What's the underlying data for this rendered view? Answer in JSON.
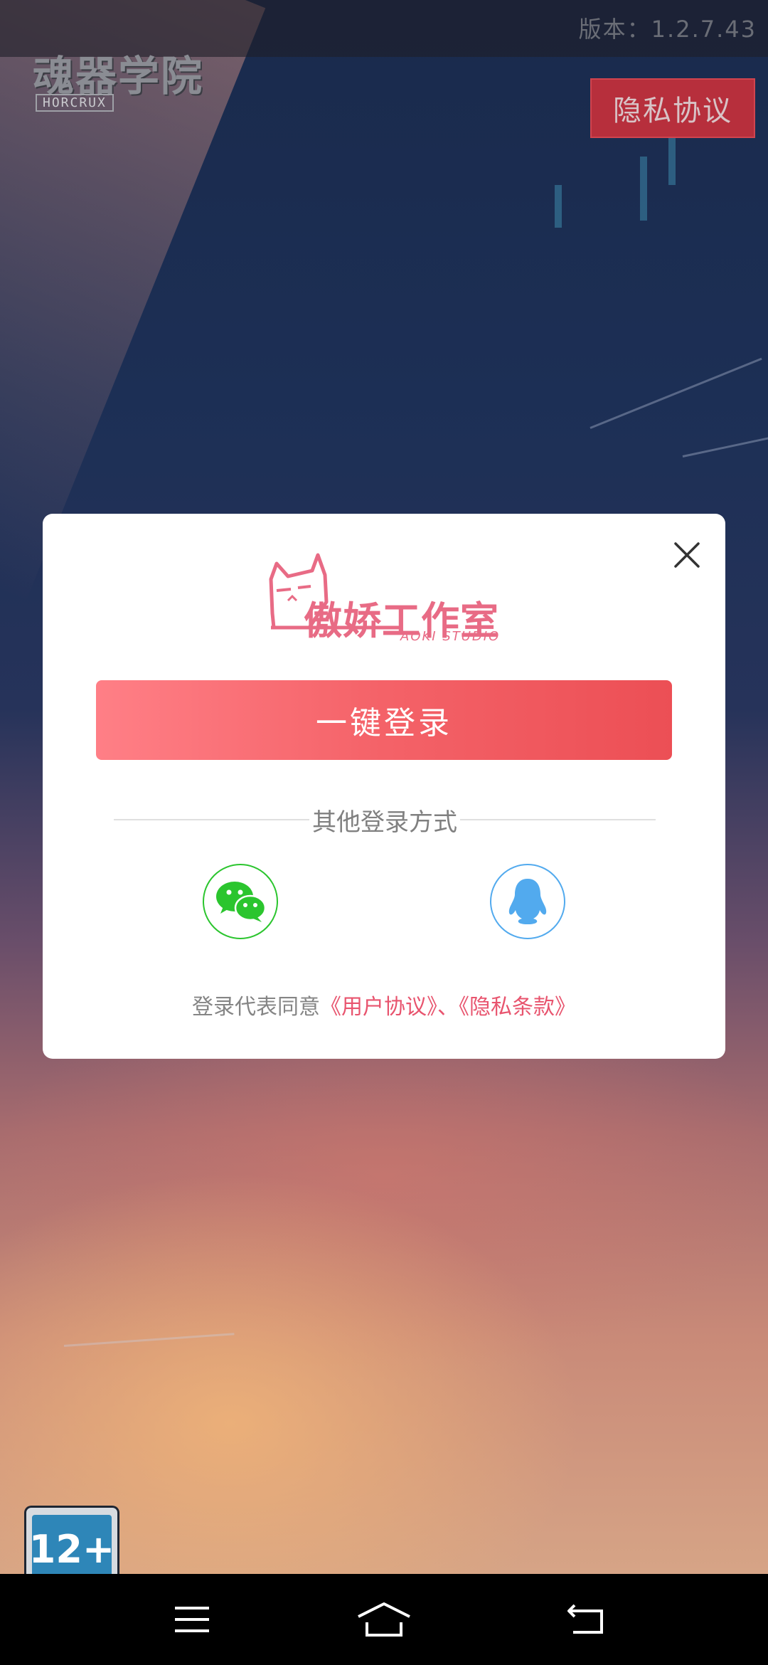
{
  "header": {
    "logo_cn": "魂器学院",
    "logo_en": "HORCRUX",
    "version": "版本：1.2.7.43",
    "privacy_button": "隐私协议"
  },
  "age_rating": "12+",
  "login_dialog": {
    "studio_logo_cn": "傲娇工作室",
    "studio_logo_en": "AOKI STUDIO",
    "one_click_login": "一键登录",
    "other_methods": "其他登录方式",
    "agreement": {
      "prefix": "登录代表同意",
      "user_agreement": "《用户协议》",
      "separator": "、",
      "privacy_terms": "《隐私条款》"
    },
    "social": {
      "wechat_icon": "wechat-icon",
      "qq_icon": "qq-icon"
    }
  },
  "navbar": {
    "icons": [
      "menu-icon",
      "home-icon",
      "back-icon"
    ]
  },
  "colors": {
    "accent": "#f05a60",
    "link": "#e8546e",
    "wechat": "#2bc52e",
    "qq": "#52aaee"
  }
}
